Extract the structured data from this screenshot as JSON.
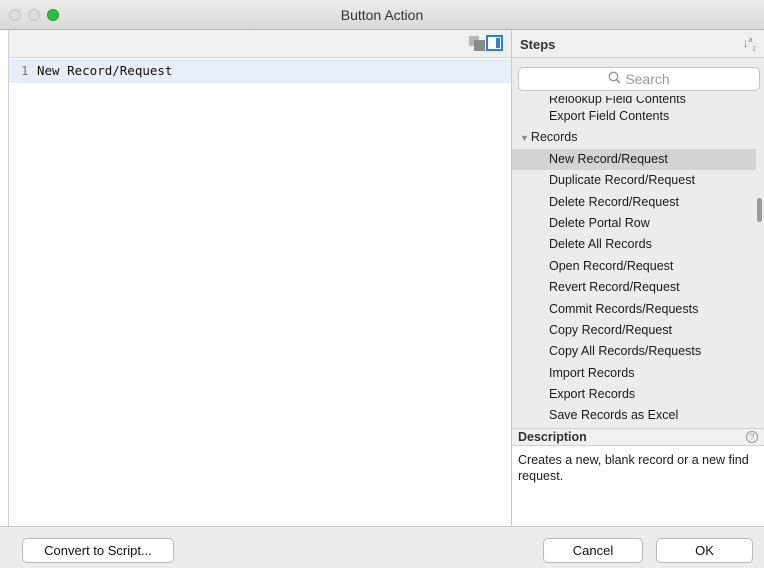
{
  "window": {
    "title": "Button Action"
  },
  "editor": {
    "lines": [
      {
        "number": "1",
        "text": "New Record/Request"
      }
    ]
  },
  "steps": {
    "title": "Steps",
    "sort_icon": "sort-az-icon",
    "search_placeholder": "Search",
    "items": [
      {
        "label": "Relookup Field Contents",
        "type": "item",
        "partial": true
      },
      {
        "label": "Export Field Contents",
        "type": "item"
      },
      {
        "label": "Records",
        "type": "category"
      },
      {
        "label": "New Record/Request",
        "type": "item",
        "selected": true
      },
      {
        "label": "Duplicate Record/Request",
        "type": "item"
      },
      {
        "label": "Delete Record/Request",
        "type": "item"
      },
      {
        "label": "Delete Portal Row",
        "type": "item"
      },
      {
        "label": "Delete All Records",
        "type": "item"
      },
      {
        "label": "Open Record/Request",
        "type": "item"
      },
      {
        "label": "Revert Record/Request",
        "type": "item"
      },
      {
        "label": "Commit Records/Requests",
        "type": "item"
      },
      {
        "label": "Copy Record/Request",
        "type": "item"
      },
      {
        "label": "Copy All Records/Requests",
        "type": "item"
      },
      {
        "label": "Import Records",
        "type": "item"
      },
      {
        "label": "Export Records",
        "type": "item"
      },
      {
        "label": "Save Records as Excel",
        "type": "item"
      }
    ]
  },
  "description": {
    "title": "Description",
    "text": "Creates a new, blank record or a new find request."
  },
  "footer": {
    "convert_label": "Convert to Script...",
    "cancel_label": "Cancel",
    "ok_label": "OK"
  }
}
